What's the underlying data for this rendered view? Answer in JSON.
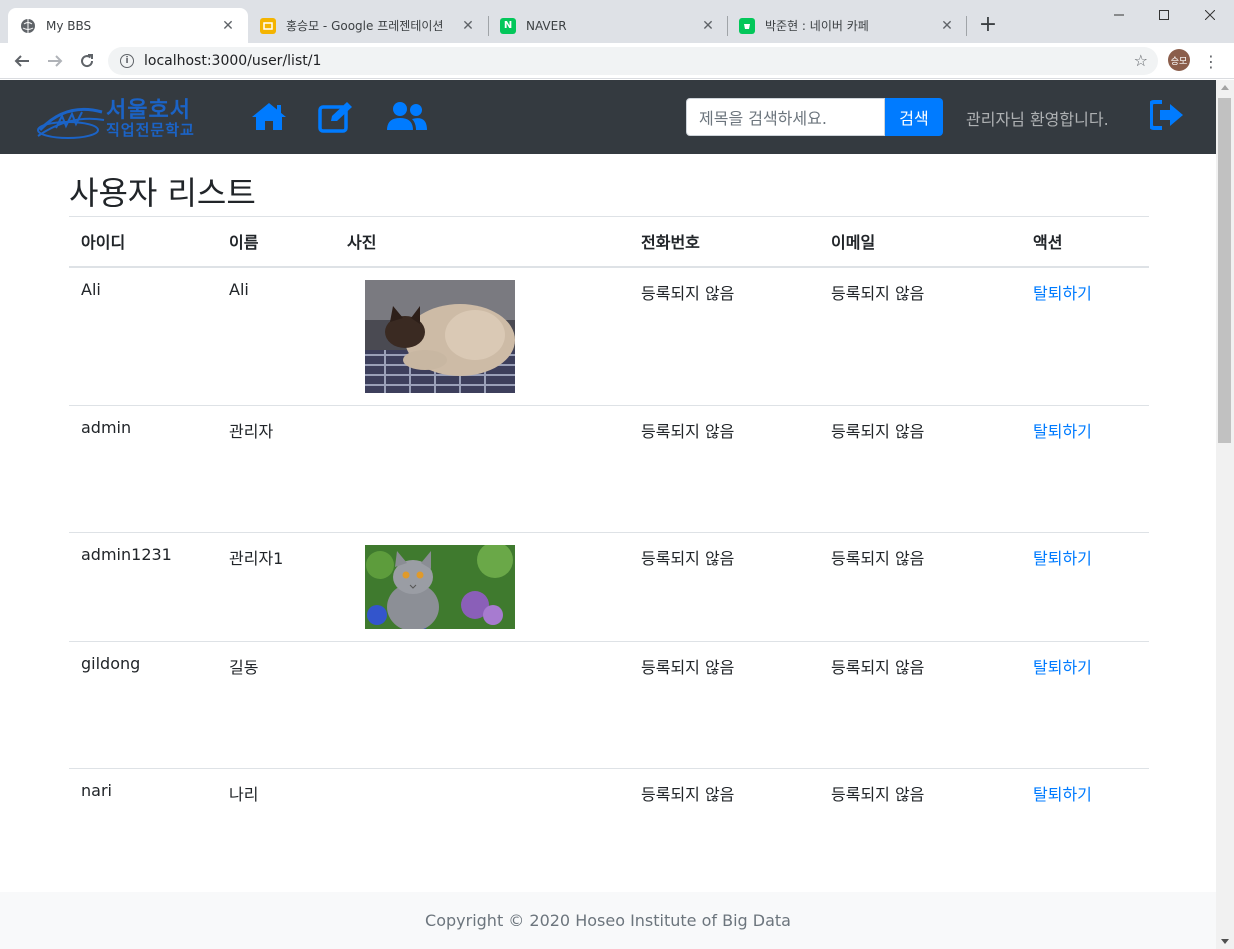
{
  "browser": {
    "tabs": [
      {
        "title": "My BBS",
        "icon": "globe-icon",
        "active": true
      },
      {
        "title": "홍승모 - Google 프레젠테이션",
        "icon": "slides-icon",
        "active": false
      },
      {
        "title": "NAVER",
        "icon": "naver-icon",
        "icon_text": "N",
        "active": false
      },
      {
        "title": "박준현 : 네이버 카페",
        "icon": "naver-cafe-icon",
        "active": false
      }
    ],
    "url": "localhost:3000/user/list/1",
    "profile_initials": "승모"
  },
  "navbar": {
    "logo_line1": "서울호서",
    "logo_line2": "직업전문학교",
    "search_placeholder": "제목을 검색하세요.",
    "search_button": "검색",
    "welcome_text": "관리자님 환영합니다."
  },
  "page": {
    "title": "사용자 리스트",
    "columns": [
      "아이디",
      "이름",
      "사진",
      "전화번호",
      "이메일",
      "액션"
    ],
    "rows": [
      {
        "id": "Ali",
        "name": "Ali",
        "photo": "siamese-cat-photo",
        "phone": "등록되지 않음",
        "email": "등록되지 않음",
        "action": "탈퇴하기"
      },
      {
        "id": "admin",
        "name": "관리자",
        "photo": "",
        "phone": "등록되지 않음",
        "email": "등록되지 않음",
        "action": "탈퇴하기"
      },
      {
        "id": "admin1231",
        "name": "관리자1",
        "photo": "gray-cat-photo",
        "phone": "등록되지 않음",
        "email": "등록되지 않음",
        "action": "탈퇴하기"
      },
      {
        "id": "gildong",
        "name": "길동",
        "photo": "",
        "phone": "등록되지 않음",
        "email": "등록되지 않음",
        "action": "탈퇴하기"
      },
      {
        "id": "nari",
        "name": "나리",
        "photo": "",
        "phone": "등록되지 않음",
        "email": "등록되지 않음",
        "action": "탈퇴하기"
      }
    ]
  },
  "footer": {
    "copyright": "Copyright © 2020 Hoseo Institute of Big Data"
  },
  "colors": {
    "navbar_bg": "#343a40",
    "accent": "#007bff",
    "logo_blue": "#1b63c6"
  }
}
